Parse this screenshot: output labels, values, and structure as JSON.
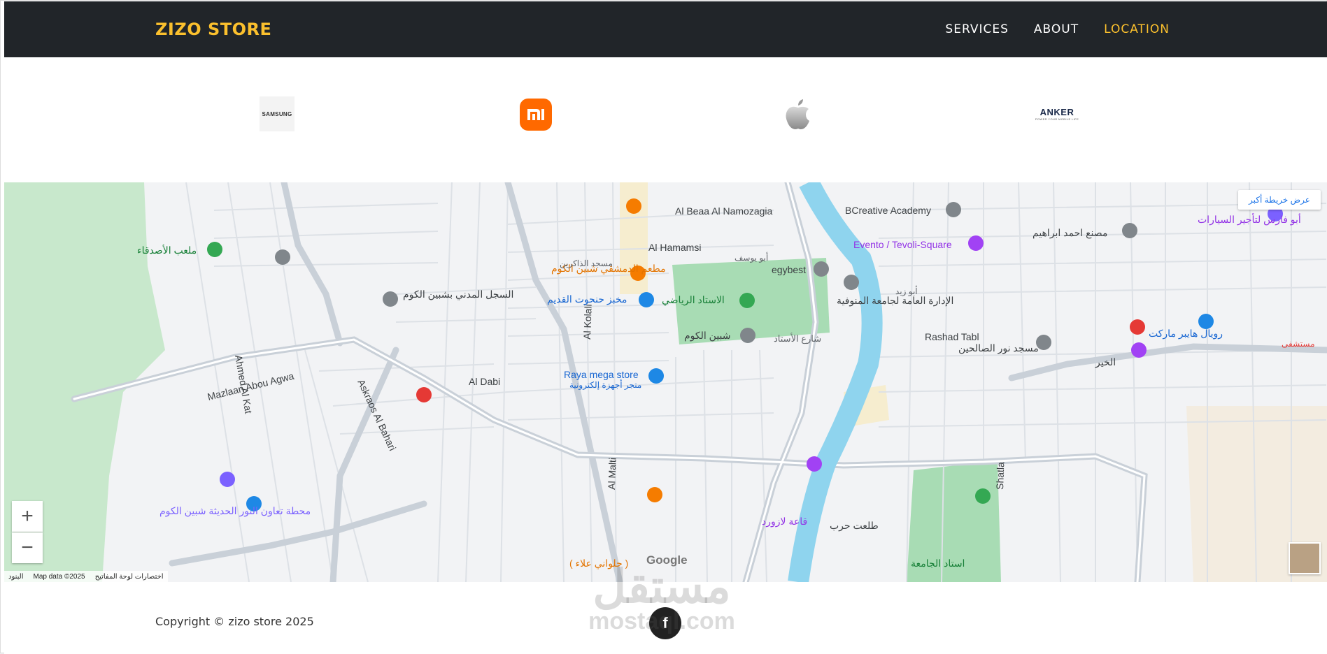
{
  "header": {
    "brand": "ZIZO STORE",
    "nav": [
      {
        "label": "SERVICES",
        "active": false
      },
      {
        "label": "ABOUT",
        "active": false
      },
      {
        "label": "LOCATION",
        "active": true
      }
    ]
  },
  "brands": {
    "samsung_text": "SAMSUNG",
    "anker_text": "ANKER",
    "anker_tagline": "POWER YOUR MOBILE LIFE"
  },
  "map": {
    "larger_map_label": "عرض خريطة أكبر",
    "zoom_in": "+",
    "zoom_out": "−",
    "attribution": {
      "terms": "البنود",
      "map_data": "Map data ©2025",
      "shortcuts": "اختصارات لوحة المفاتيح"
    },
    "google_logo": "Google",
    "labels": [
      "Al Beaa Al Namozagia",
      "Al Hamamsi",
      "BCreative Academy",
      "Evento / Tevoli-Square",
      "egybest",
      "Rashad Tabl",
      "Raya mega store",
      "متجر أجهزة إلكترونية",
      "Mazlaan Abou Agwa",
      "Askraos Al Bahari",
      "Al Dabi",
      "Al Kolali",
      "Al Malti",
      "Shatla",
      "Ahmed Al Kat",
      "ملعب الأصدقاء",
      "مطعم الدمشقي شبين الكوم",
      "مخبز حنحوت القديم",
      "السجل المدني بشبين الكوم",
      "الاستاد الرياضي",
      "شبين الكوم",
      "الإدارة العامة لجامعة المنوفية",
      "مصنع احمد ابراهيم",
      "أبو فارس لتأجير السيارات",
      "رويال هايبر ماركت",
      "مسجد نور الصالحين",
      "قاعة لازورد",
      "محطة تعاون النور الحديثة شبين الكوم",
      "استاد الجامعة",
      "( حلواني علاء )",
      "طلعت حرب",
      "الخير",
      "مستشفى",
      "مسجد الذاكرين",
      "أبو يوسف",
      "أبو زيد",
      "شارع الأستاد"
    ]
  },
  "footer": {
    "copyright": "Copyright © zizo store 2025",
    "facebook_icon_glyph": "f"
  },
  "watermark": {
    "arabic": "مستقل",
    "latin": "mostaql.com"
  },
  "colors": {
    "navbar_bg": "#212529",
    "accent": "#fbc02d",
    "river": "#8fd4ee",
    "park": "#a8dcb4"
  }
}
